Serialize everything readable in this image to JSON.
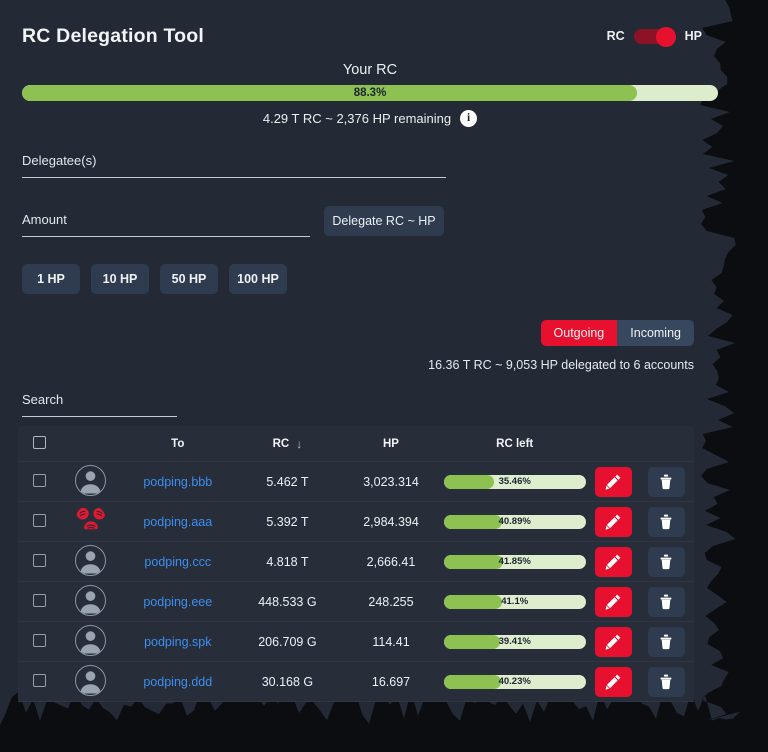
{
  "header": {
    "title": "RC Delegation Tool",
    "toggle": {
      "left_label": "RC",
      "right_label": "HP",
      "state": "HP",
      "track_color": "#8c1326",
      "knob_color": "#e8102f"
    }
  },
  "rc_meter": {
    "caption": "Your RC",
    "percent_label": "88.3%",
    "percent_value": 88.3,
    "remaining_text": "4.29 T RC ~ 2,376 HP remaining",
    "info_icon": "info-icon",
    "info_glyph": "i",
    "fill_color": "#8dc152",
    "track_color": "#ddeccb"
  },
  "form": {
    "delegatee_label": "Delegatee(s)",
    "delegatee_value": "",
    "amount_label": "Amount",
    "amount_value": "",
    "delegate_button": "Delegate RC ~ HP",
    "quick_amounts": [
      "1 HP",
      "10 HP",
      "50 HP",
      "100 HP"
    ]
  },
  "tabs": {
    "items": [
      {
        "label": "Outgoing",
        "active": true
      },
      {
        "label": "Incoming",
        "active": false
      }
    ],
    "active_color": "#e8102f",
    "inactive_color": "#37475d"
  },
  "summary": "16.36 T RC ~ 9,053 HP delegated to 6 accounts",
  "search": {
    "label": "Search",
    "value": ""
  },
  "table": {
    "columns": [
      "",
      "",
      "To",
      "RC",
      "HP",
      "RC left",
      "",
      ""
    ],
    "sort_column": "RC",
    "sort_direction": "desc",
    "sort_arrow": "↓",
    "select_all_checked": false,
    "rows": [
      {
        "checked": false,
        "avatar": "user-avatar",
        "to": "podping.bbb",
        "rc": "5.462 T",
        "hp": "3,023.314",
        "rc_left_label": "35.46%",
        "rc_left_value": 35.46
      },
      {
        "checked": false,
        "avatar": "podping-logo",
        "to": "podping.aaa",
        "rc": "5.392 T",
        "hp": "2,984.394",
        "rc_left_label": "40.89%",
        "rc_left_value": 40.89
      },
      {
        "checked": false,
        "avatar": "user-avatar",
        "to": "podping.ccc",
        "rc": "4.818 T",
        "hp": "2,666.41",
        "rc_left_label": "41.85%",
        "rc_left_value": 41.85
      },
      {
        "checked": false,
        "avatar": "user-avatar",
        "to": "podping.eee",
        "rc": "448.533 G",
        "hp": "248.255",
        "rc_left_label": "41.1%",
        "rc_left_value": 41.1
      },
      {
        "checked": false,
        "avatar": "user-avatar",
        "to": "podping.spk",
        "rc": "206.709 G",
        "hp": "114.41",
        "rc_left_label": "39.41%",
        "rc_left_value": 39.41
      },
      {
        "checked": false,
        "avatar": "user-avatar",
        "to": "podping.ddd",
        "rc": "30.168 G",
        "hp": "16.697",
        "rc_left_label": "40.23%",
        "rc_left_value": 40.23
      }
    ],
    "row_actions": {
      "edit_icon": "pencil-icon",
      "delete_icon": "trash-icon",
      "edit_color": "#e8102f",
      "delete_color": "#2f3b4e"
    }
  },
  "theme": {
    "page_background": "#0b0d11",
    "panel_background": "#242a35",
    "table_background": "#272e3a",
    "link_color": "#3c8ef0",
    "accent_red": "#e8102f",
    "accent_green": "#8dc152"
  }
}
